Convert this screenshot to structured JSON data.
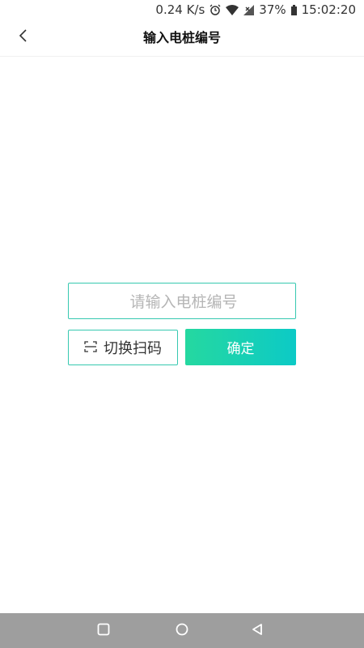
{
  "status_bar": {
    "speed": "0.24 K/s",
    "battery": "37%",
    "time": "15:02:20",
    "icons": [
      "alarm-icon",
      "wifi-icon",
      "no-signal-icon",
      "battery-icon"
    ]
  },
  "header": {
    "title": "输入电桩编号",
    "back_icon": "chevron-left-icon"
  },
  "form": {
    "input_placeholder": "请输入电桩编号",
    "input_value": "",
    "scan_button_label": "切换扫码",
    "scan_icon": "scan-icon",
    "confirm_button_label": "确定"
  },
  "nav_bar": {
    "icons": [
      "recent-apps-icon",
      "home-icon",
      "back-icon"
    ]
  },
  "colors": {
    "accent_border": "#36c8b0",
    "gradient_start": "#25d8a0",
    "gradient_end": "#0ccac6",
    "nav_bar_bg": "#9e9e9e"
  }
}
